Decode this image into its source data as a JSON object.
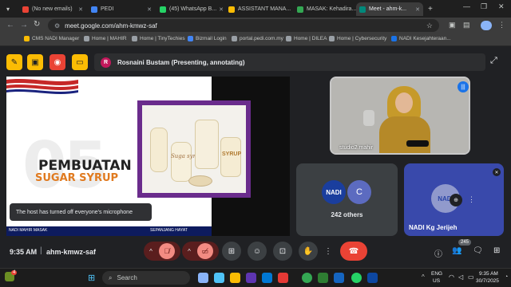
{
  "browser": {
    "tabs": [
      {
        "title": "(No new emails)",
        "color": "#ea4335"
      },
      {
        "title": "PEDI",
        "color": "#4285f4"
      },
      {
        "title": "(45) WhatsApp B...",
        "color": "#25d366"
      },
      {
        "title": "ASSISTANT MANA...",
        "color": "#fbbc04"
      },
      {
        "title": "MASAK: Kehadira...",
        "color": "#34a853"
      },
      {
        "title": "Meet - ahm-k...",
        "color": "#00897b"
      }
    ],
    "new_tab": "+",
    "url": "meet.google.com/ahm-kmwz-saf",
    "bookmarks": [
      "CMS NADI Manager",
      "Home | MAHIR",
      "Home | TinyTechies",
      "Bizmail Login",
      "portal.pedi.com.my",
      "Home | DILEA",
      "Home | Cybersecurity",
      "NADI Kesejahteraan..."
    ]
  },
  "meet": {
    "presenter_initial": "R",
    "presenter_text": "Rosnaini Bustam (Presenting, annotating)",
    "slide": {
      "title_line1": "PEMBUATAN",
      "title_line2": "SUGAR SYRUP",
      "watermark": "05",
      "footer_left": "NADI MAHIR MASAK",
      "footer_right": "SEPANJANG HAYAT",
      "jar_label_left": "Suga syrup",
      "jar_label_right": "SYRUP"
    },
    "toast": "The host has turned off everyone's microphone",
    "self_tile_name": "studio2.mahir",
    "others_count": "242 others",
    "others_initial": "C",
    "nadi_logo": "NADI",
    "nadi_tile_name": "NADI Kg Jerijeh",
    "time": "9:35 AM",
    "meeting_code": "ahm-kmwz-saf",
    "people_badge": "245",
    "end_color": "#ea4335"
  },
  "taskbar": {
    "search": "Search",
    "lang": "ENG",
    "region": "US",
    "clock_time": "9:35 AM",
    "clock_date": "30/7/2025",
    "notif_badge": "4"
  }
}
